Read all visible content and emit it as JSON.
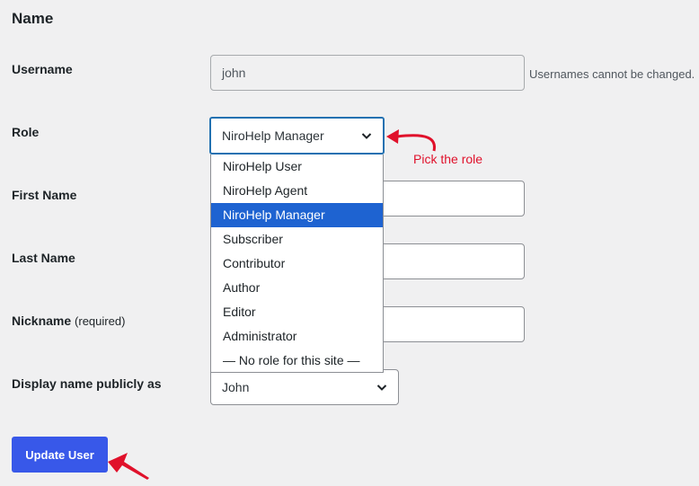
{
  "section": {
    "title": "Name"
  },
  "username": {
    "label": "Username",
    "value": "john",
    "hint": "Usernames cannot be changed."
  },
  "role": {
    "label": "Role",
    "selected": "NiroHelp Manager",
    "options": [
      "NiroHelp User",
      "NiroHelp Agent",
      "NiroHelp Manager",
      "Subscriber",
      "Contributor",
      "Author",
      "Editor",
      "Administrator",
      "— No role for this site —"
    ]
  },
  "first_name": {
    "label": "First Name"
  },
  "last_name": {
    "label": "Last Name"
  },
  "nickname": {
    "label": "Nickname",
    "required_note": "(required)"
  },
  "display_name": {
    "label": "Display name publicly as",
    "selected": "John"
  },
  "update_button": {
    "label": "Update User"
  },
  "annotation": {
    "text": "Pick the role",
    "color": "#e0112b"
  },
  "colors": {
    "accent": "#3858e9",
    "highlight": "#1e63d1",
    "focus": "#2271b1",
    "annotation": "#e0112b"
  },
  "icons": {
    "select_arrow": "chevron-down-icon",
    "pointer": "red-arrow-icon"
  }
}
